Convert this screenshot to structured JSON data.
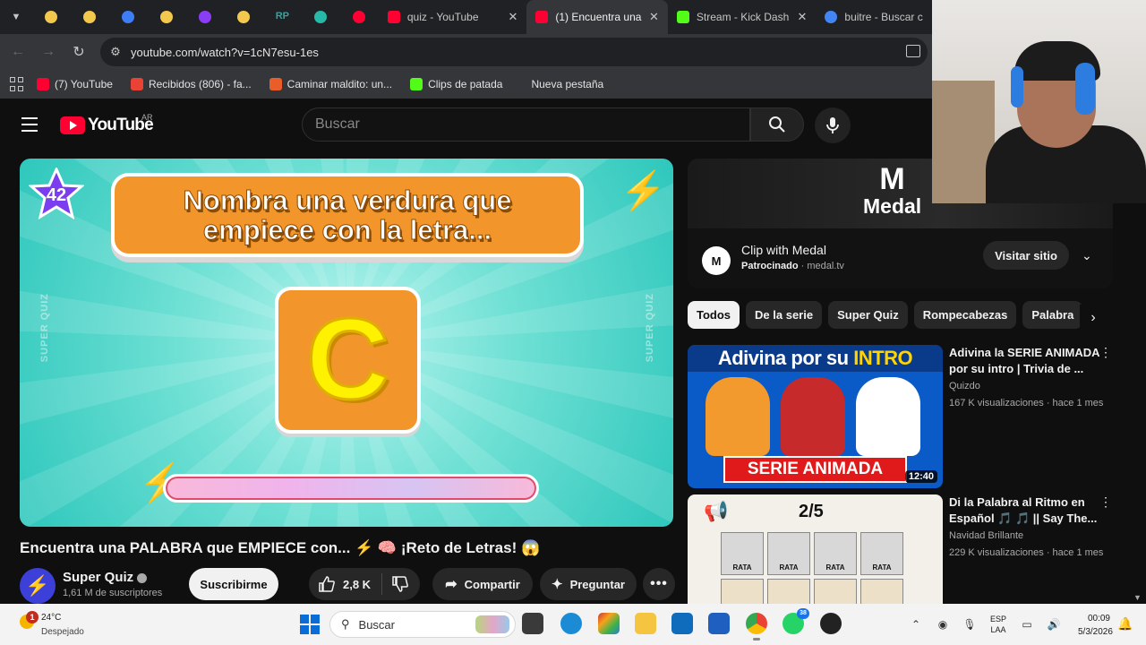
{
  "browser": {
    "pinned_tab_colors": [
      "#f2c94c",
      "#f2c94c",
      "#3d7df5",
      "#f2c94c",
      "#8b3df5",
      "#f2c94c",
      "#3aa0a0",
      "#28b8a8",
      "#ff0033"
    ],
    "pinned_tab_texts": [
      "",
      "",
      "",
      "",
      "",
      "",
      "RP",
      "",
      ""
    ],
    "tabs": [
      {
        "label": "quiz - YouTube",
        "color": "#ff0033"
      },
      {
        "label": "(1) Encuentra una P",
        "color": "#ff0033"
      },
      {
        "label": "Stream - Kick Dash",
        "color": "#53fc18"
      },
      {
        "label": "buitre - Buscar con",
        "color": "#4285f4"
      }
    ],
    "url": "youtube.com/watch?v=1cN7esu-1es",
    "bookmarks": [
      {
        "label": "(7) YouTube",
        "color": "#ff0033"
      },
      {
        "label": "Recibidos (806) - fa...",
        "color": "#ea4335"
      },
      {
        "label": "Caminar maldito: un...",
        "color": "#e85d2a"
      },
      {
        "label": "Clips de patada",
        "color": "#53fc18"
      },
      {
        "label": "Nueva pestaña",
        "color": ""
      }
    ]
  },
  "youtube": {
    "logo_text": "YouTube",
    "country": "AR",
    "search_placeholder": "Buscar"
  },
  "player": {
    "question_number": "42",
    "prompt": "Nombra una verdura que empiece con la letra...",
    "letter": "C",
    "side_text": "SUPER QUIZ",
    "timer_fraction": 1.0
  },
  "video": {
    "title": "Encuentra una PALABRA que EMPIECE con... ⚡ 🧠 ¡Reto de Letras! 😱",
    "channel": "Super Quiz",
    "subscribers": "1,61 M de suscriptores",
    "subscribe_label": "Suscribirme",
    "likes": "2,8 K",
    "share_label": "Compartir",
    "ask_label": "Preguntar"
  },
  "ad": {
    "brand_mark": "M",
    "brand_word": "Medal",
    "title": "Clip with Medal",
    "sponsored": "Patrocinado",
    "domain": "medal.tv",
    "visit_label": "Visitar sitio"
  },
  "chips": [
    "Todos",
    "De la serie",
    "Super Quiz",
    "Rompecabezas",
    "Palabra"
  ],
  "recommendations": [
    {
      "title": "Adivina la SERIE ANIMADA por su intro | Trivia de ...",
      "channel": "Quizdo",
      "meta": "167 K visualizaciones · hace 1 mes",
      "duration": "12:40",
      "thumb_top_text": "Adivina por su",
      "thumb_top_highlight": "INTRO",
      "thumb_bottom_text": "SERIE ANIMADA"
    },
    {
      "title": "Di la Palabra al Ritmo en Español 🎵 🎵 || Say The...",
      "channel": "Navidad Brillante",
      "meta": "229 K visualizaciones · hace 1 mes",
      "thumb_fraction": "2/5",
      "thumb_cell_label": "RATA"
    }
  ],
  "taskbar": {
    "notification_count": "1",
    "temperature": "24°C",
    "condition": "Despejado",
    "search_label": "Buscar",
    "app_badge": "38",
    "language_top": "ESP",
    "language_bottom": "LAA",
    "time": "00:09",
    "date": "5/3/2026"
  }
}
